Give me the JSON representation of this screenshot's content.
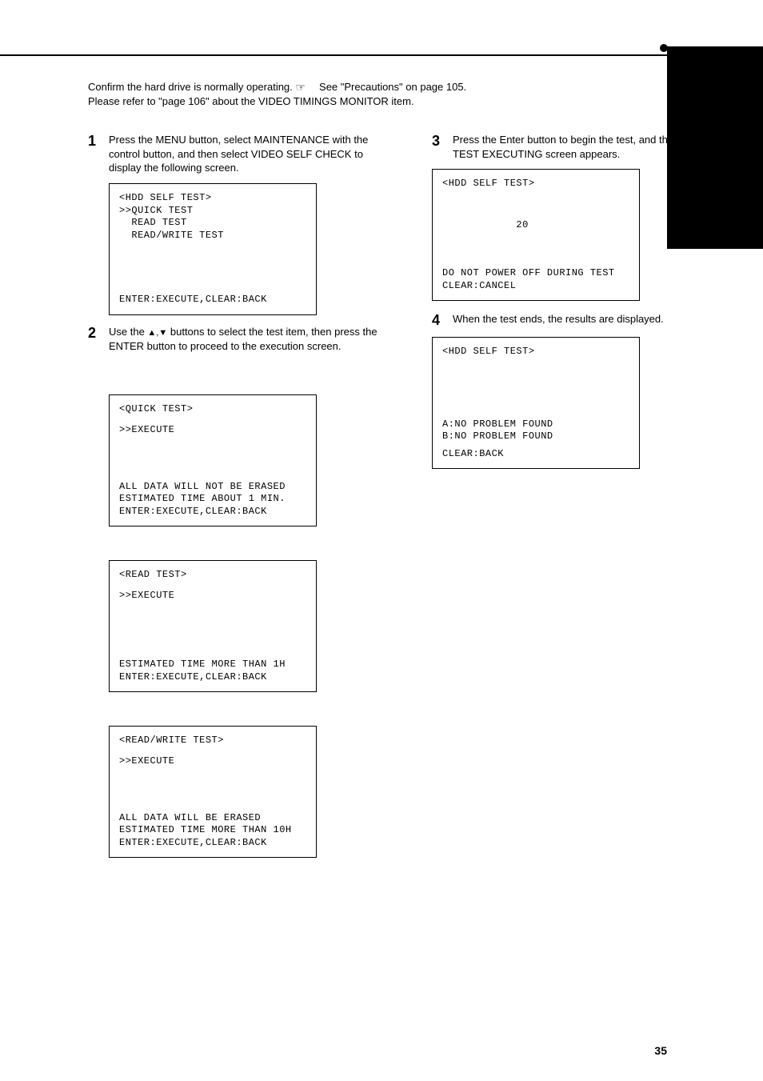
{
  "intro": {
    "line1_prefix": "Confirm the hard drive is normally operating.",
    "line1_hand_after": " See \"Precautions\" on page 105.",
    "line2": "Please refer to \"page 106\" about the VIDEO TIMINGS MONITOR item."
  },
  "left": {
    "step1": {
      "num": "1",
      "text": "Press the MENU button, select MAINTENANCE with the control button, and then select VIDEO SELF CHECK to display the following screen."
    },
    "screen_sel": {
      "t1": "<HDD SELF TEST>",
      "t2": ">>QUICK TEST",
      "t3": "  READ TEST",
      "t4": "  READ/WRITE TEST",
      "bot": "ENTER:EXECUTE,CLEAR:BACK"
    },
    "step2": {
      "num": "2",
      "text_a": "Use the ",
      "arrows": "▲,▼",
      "text_b": " buttons to select the test item, then press the ENTER button to proceed to the execution screen."
    },
    "screen_quick": {
      "t1": "<QUICK TEST>",
      "t2": ">>EXECUTE",
      "b1": "ALL DATA WILL NOT BE ERASED",
      "b2": "ESTIMATED TIME ABOUT 1 MIN.",
      "b3": "ENTER:EXECUTE,CLEAR:BACK"
    },
    "screen_read": {
      "t1": "<READ TEST>",
      "t2": ">>EXECUTE",
      "b1": "ESTIMATED TIME MORE THAN 1H",
      "b2": "ENTER:EXECUTE,CLEAR:BACK"
    },
    "screen_rw": {
      "t1": "<READ/WRITE TEST>",
      "t2": ">>EXECUTE",
      "b1": "ALL DATA WILL BE ERASED",
      "b2": "ESTIMATED TIME MORE THAN 10H",
      "b3": "ENTER:EXECUTE,CLEAR:BACK"
    }
  },
  "right": {
    "step3": {
      "num": "3",
      "text": "Press the Enter button to begin the test, and the TEST EXECUTING screen appears."
    },
    "screen_prog": {
      "t1": "<HDD SELF TEST>",
      "t2": "            20",
      "b1": "DO NOT POWER OFF DURING TEST",
      "b2": "CLEAR:CANCEL"
    },
    "step4": {
      "num": "4",
      "text": "When the test ends, the results are displayed."
    },
    "screen_res": {
      "t1": "<HDD SELF TEST>",
      "b1": "A:NO PROBLEM FOUND",
      "b2": "B:NO PROBLEM FOUND",
      "b3": "CLEAR:BACK"
    }
  },
  "page_num": "35"
}
